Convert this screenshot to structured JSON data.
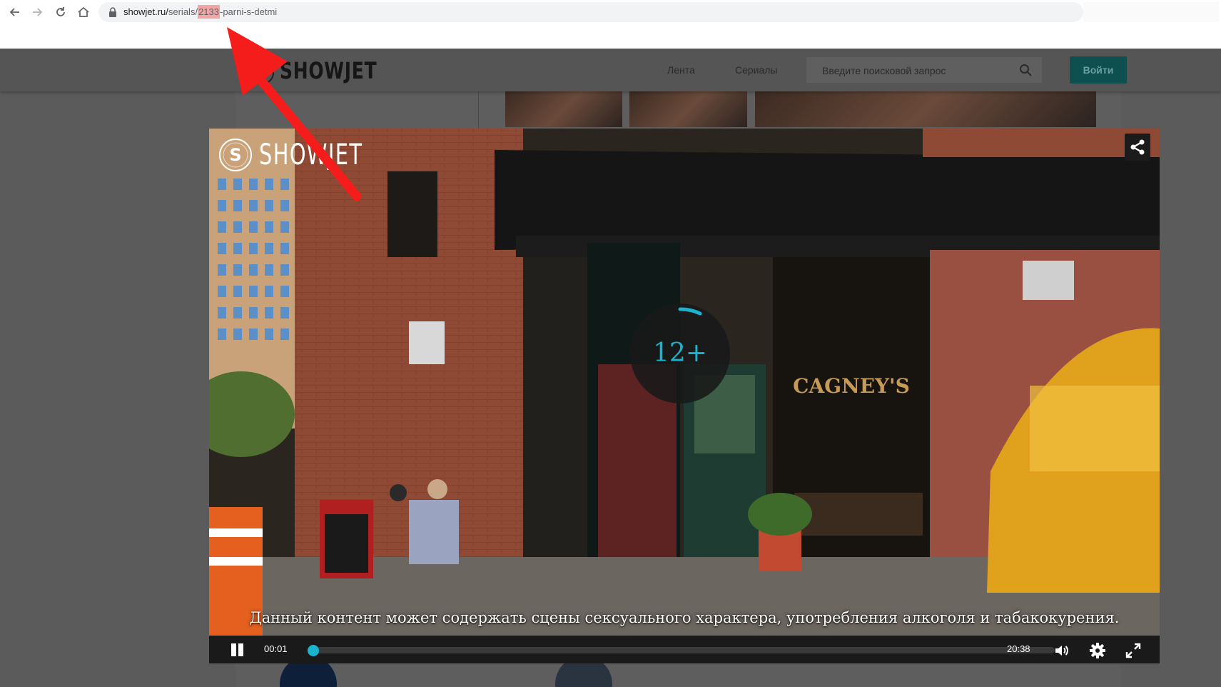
{
  "browser": {
    "url_host": "showjet.ru/",
    "url_path_before": "serials/",
    "url_highlight": "2133",
    "url_path_after": "-parni-s-detmi",
    "back_icon": "arrow-left-icon",
    "forward_icon": "arrow-right-icon",
    "reload_icon": "reload-icon",
    "home_icon": "home-icon",
    "lock_icon": "lock-icon",
    "highlight_color": "#f4a4a4"
  },
  "site_header": {
    "logo": "SHOWJET",
    "nav": [
      {
        "label": "Лента"
      },
      {
        "label": "Сериалы"
      }
    ],
    "search_placeholder": "Введите поисковой запрос",
    "login_label": "Войти",
    "accent": "#0e4f4f"
  },
  "player": {
    "logo": "SHOWJET",
    "age_rating": "12+",
    "warning": "Данный контент может содержать сцены сексуального характера, употребления алкоголя и табакокурения.",
    "current_time": "00:01",
    "duration": "20:38",
    "progress_fraction": 0.001,
    "accent": "#1ab4cf",
    "icons": [
      "share-icon",
      "close-icon",
      "pause-icon",
      "volume-icon",
      "settings-gear-icon",
      "fullscreen-icon"
    ]
  },
  "annotation": {
    "color": "#f51c1c",
    "shape": "arrow"
  }
}
